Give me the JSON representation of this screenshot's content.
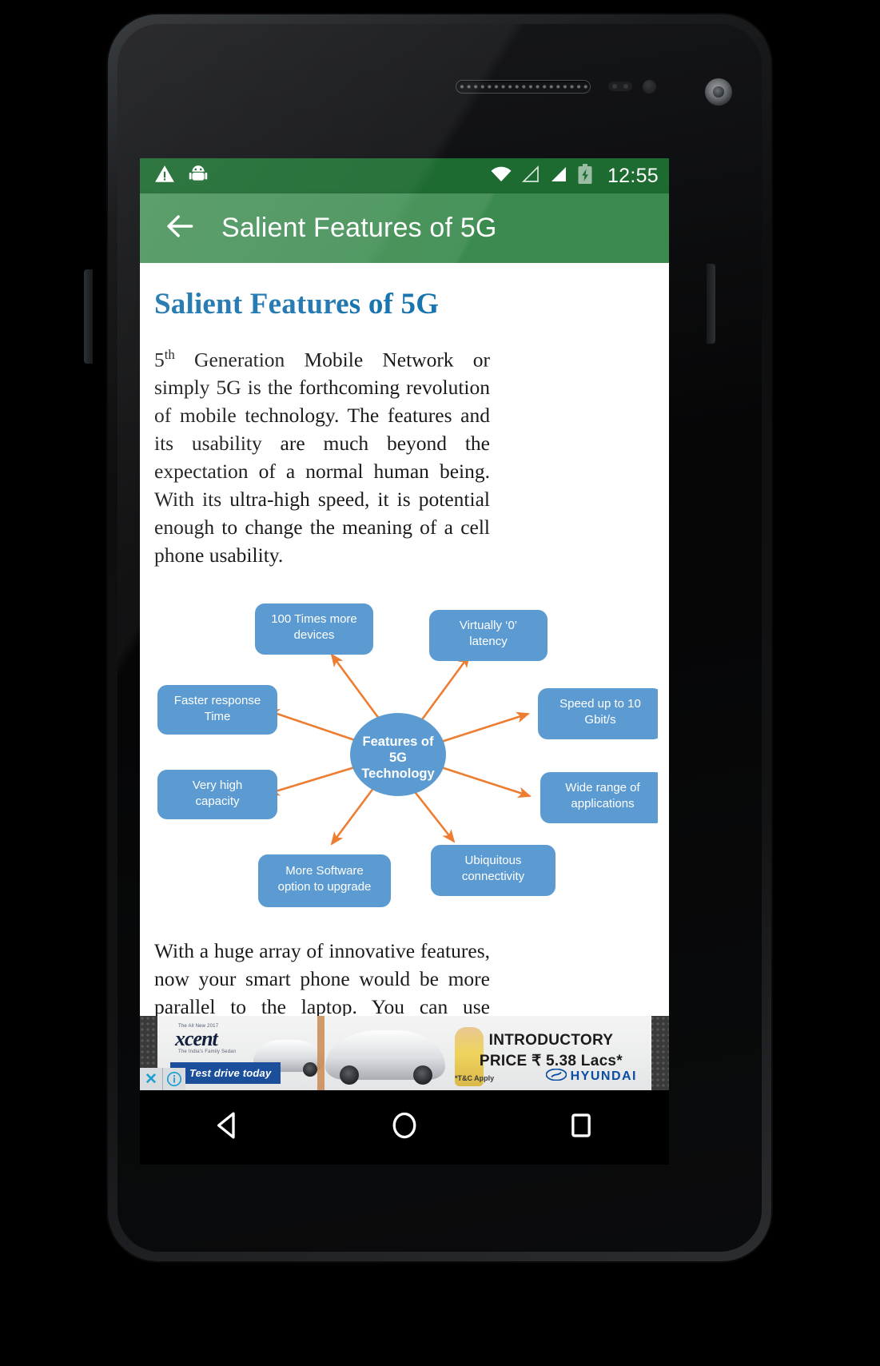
{
  "device": {
    "hardware": {
      "earpiece": "earpiece-grille",
      "proximity_sensor": "proximity-sensor",
      "light_sensor": "light-sensor",
      "front_camera": "front-camera",
      "volume_rocker": "volume-button",
      "power_button": "power-button"
    }
  },
  "status_bar": {
    "time": "12:55",
    "background_color": "#1e6b32",
    "icons_left": [
      "warning-triangle-icon",
      "android-debug-icon"
    ],
    "icons_right": [
      "wifi-icon",
      "signal-empty-icon",
      "signal-full-icon",
      "battery-charging-icon"
    ]
  },
  "app_bar": {
    "title": "Salient Features of 5G",
    "back_icon": "arrow-left-icon",
    "background_color": "#3b8b4f",
    "text_color": "#ffffff"
  },
  "article": {
    "heading": "Salient Features of 5G",
    "heading_color": "#1a74ae",
    "paragraph_1_prefix": "5",
    "paragraph_1_sup": "th",
    "paragraph_1": " Generation Mobile Network or simply 5G is the forthcoming revolution of mobile technology. The features and its usability are much beyond the expectation of a normal human being. With its ultra-high speed, it is potential enough to change the meaning of a cell phone usability.",
    "paragraph_2": "With a huge array of innovative features, now your smart phone would be more parallel to the laptop. You can use broadband internet connection; other significant features that fascinate people are more gaming options, wider multimedia options, connectivity everywhere, zero latency, faster response time, and high"
  },
  "diagram": {
    "center_lines": [
      "Features of",
      "5G",
      "Technology"
    ],
    "node_fill": "#5b9bd1",
    "arrow_color": "#ed7d31",
    "nodes": [
      {
        "id": "devices",
        "lines": [
          "100 Times more",
          "devices"
        ]
      },
      {
        "id": "latency",
        "lines": [
          "Virtually ‘0’",
          "latency"
        ]
      },
      {
        "id": "speed",
        "lines": [
          "Speed up to 10",
          "Gbit/s"
        ]
      },
      {
        "id": "applications",
        "lines": [
          "Wide range of",
          "applications"
        ]
      },
      {
        "id": "connectivity",
        "lines": [
          "Ubiquitous",
          "connectivity"
        ]
      },
      {
        "id": "software",
        "lines": [
          "More Software",
          "option to upgrade"
        ]
      },
      {
        "id": "capacity",
        "lines": [
          "Very high",
          "capacity"
        ]
      },
      {
        "id": "response",
        "lines": [
          "Faster response",
          "Time"
        ]
      }
    ]
  },
  "ad": {
    "brand_logo": "xcent",
    "tagline_top": "The All New 2017",
    "tagline_bottom": "The India's Family Sedan",
    "cta": "Test drive today",
    "headline_line1": "INTRODUCTORY",
    "headline_line2": "PRICE ₹ 5.38 Lacs*",
    "terms": "*T&C Apply",
    "advertiser": "HYUNDAI",
    "close_icon": "close-x-icon",
    "info_icon": "info-circle-icon"
  },
  "nav_bar": {
    "back": "back-triangle-icon",
    "home": "home-circle-icon",
    "recents": "recents-square-icon"
  }
}
